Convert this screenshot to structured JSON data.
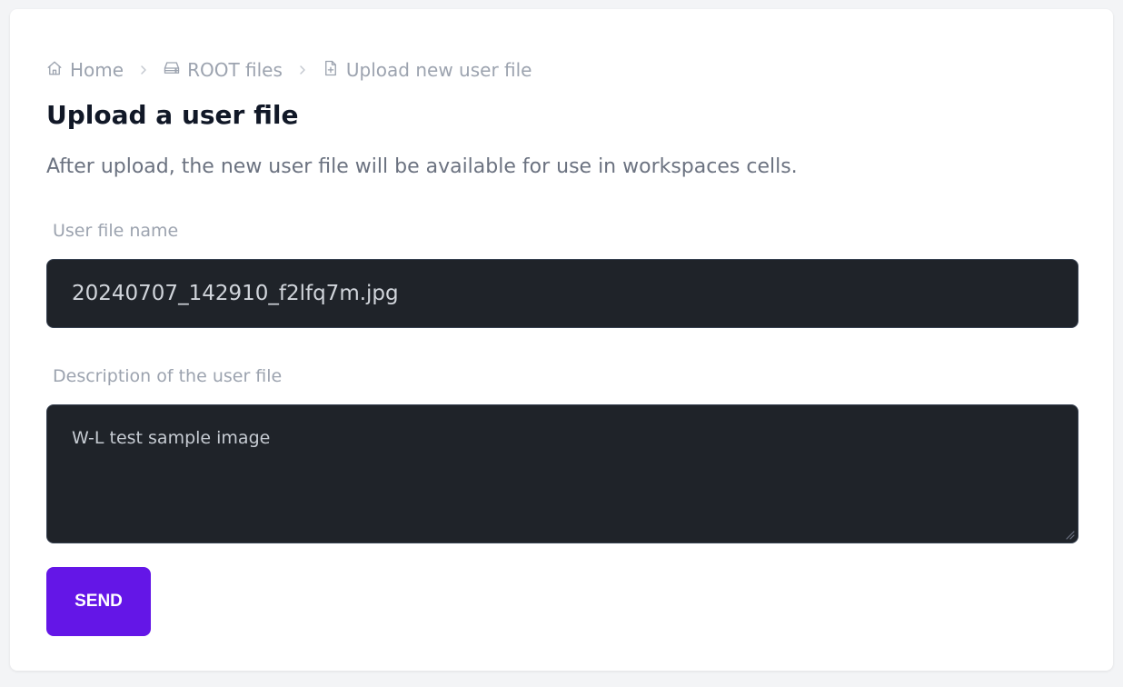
{
  "breadcrumb": {
    "items": [
      {
        "label": "Home",
        "icon": "home-icon"
      },
      {
        "label": "ROOT files",
        "icon": "server-icon"
      },
      {
        "label": "Upload new user file",
        "icon": "file-plus-icon"
      }
    ]
  },
  "page": {
    "title": "Upload a user file",
    "subtitle": "After upload, the new user file will be available for use in workspaces cells."
  },
  "form": {
    "name_label": "User file name",
    "name_value": "20240707_142910_f2lfq7m.jpg",
    "description_label": "Description of the user file",
    "description_value": "W-L test sample image",
    "submit_label": "SEND"
  },
  "colors": {
    "accent": "#6416e7",
    "field_background": "#1f2329",
    "muted_text": "#9ca3af",
    "title_text": "#111827"
  }
}
